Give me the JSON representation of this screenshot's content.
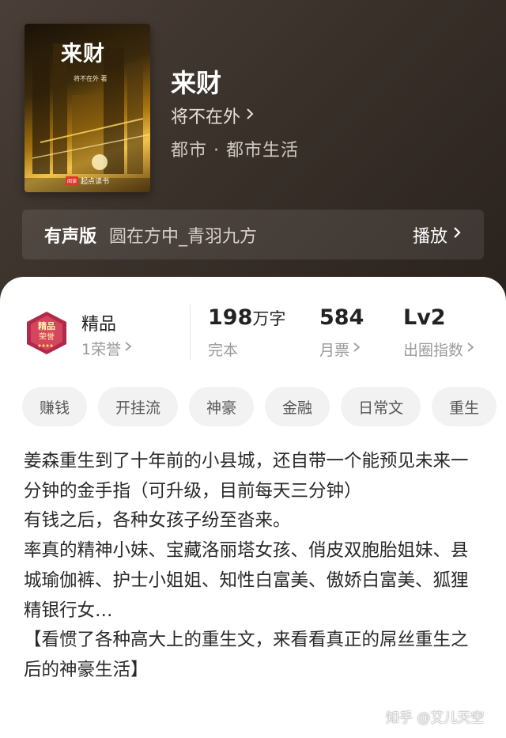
{
  "book": {
    "cover_title": "来财",
    "cover_author": "将不在外 著",
    "cover_publisher": "起点读书",
    "cover_publisher_badge": "阅读",
    "title": "来财",
    "author": "将不在外",
    "genre": "都市 · 都市生活"
  },
  "audio": {
    "label": "有声版",
    "narrator": "圆在方中_青羽九方",
    "play_label": "播放"
  },
  "stats": {
    "badge_label": "精品",
    "honors": "1荣誉",
    "word_count": "198",
    "word_unit": "万字",
    "status": "完本",
    "monthly_votes": "584",
    "monthly_votes_label": "月票",
    "level": "Lv2",
    "level_label": "出圈指数"
  },
  "tags": [
    "赚钱",
    "开挂流",
    "神豪",
    "金融",
    "日常文",
    "重生"
  ],
  "description": [
    "姜森重生到了十年前的小县城，还自带一个能预见未来一分钟的金手指（可升级，目前每天三分钟）",
    "有钱之后，各种女孩子纷至沓来。",
    "率真的精神小妹、宝藏洛丽塔女孩、俏皮双胞胎姐妹、县城瑜伽裤、护士小姐姐、知性白富美、傲娇白富美、狐狸精银行女…",
    "【看惯了各种高大上的重生文，来看看真正的屌丝重生之后的神豪生活】"
  ],
  "watermark": "知乎 @艾儿天空",
  "icons": {
    "chevron": "chevron-right-icon",
    "badge": "quality-badge-icon"
  },
  "colors": {
    "hero_bg": "#3a312b",
    "sheet_bg": "#ffffff",
    "tag_bg": "#f2f2f2",
    "badge_accent": "#b22a4a"
  }
}
